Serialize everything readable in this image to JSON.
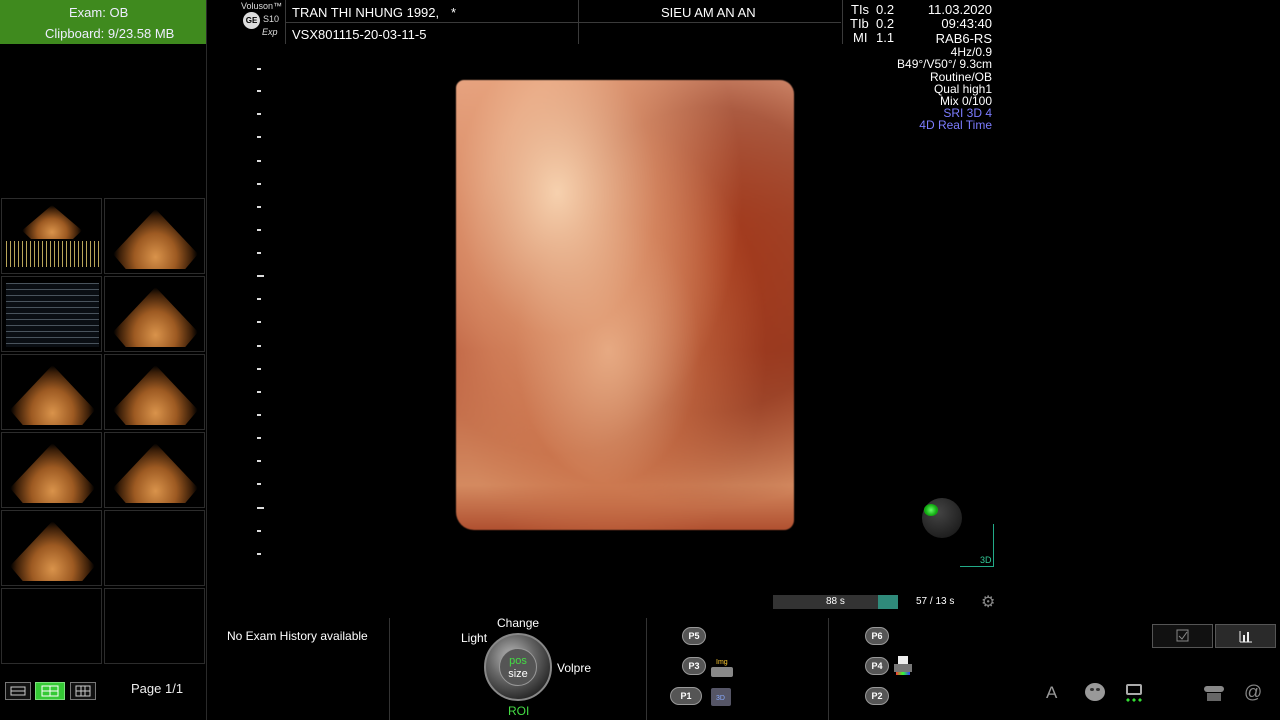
{
  "left_panel": {
    "exam_label": "Exam: OB",
    "clipboard_label": "Clipboard: 9/23.58 MB",
    "page_label": "Page 1/1"
  },
  "header": {
    "brand": "Voluson™",
    "model": "S10",
    "model_sub": "Exp",
    "ge_logo": "GE",
    "patient_name": "TRAN THI NHUNG 1992,",
    "patient_flag": "*",
    "patient_id": "VSX801115-20-03-11-5",
    "facility": "SIEU AM AN AN",
    "tis_label": "TIs",
    "tis_value": "0.2",
    "tib_label": "TIb",
    "tib_value": "0.2",
    "mi_label": "MI",
    "mi_value": "1.1",
    "date": "11.03.2020",
    "time": "09:43:40",
    "probe": "RAB6-RS"
  },
  "scan_info": {
    "freq": "4Hz/0.9",
    "angles": "B49°/V50°/ 9.3cm",
    "preset": "Routine/OB",
    "quality": "Qual high1",
    "mix": "Mix 0/100",
    "sri": "SRI 3D 4",
    "mode": "4D Real Time"
  },
  "viewer": {
    "orientation_label": "3D",
    "cine_time": "88 s",
    "cine_frames": "57 / 13 s",
    "cine_fill_fraction": 0.16
  },
  "bottom": {
    "exam_history": "No Exam History available",
    "dial_top": "Change",
    "dial_left": "Light",
    "dial_right": "Volpre",
    "dial_bottom": "ROI",
    "dial_center_top": "pos",
    "dial_center_bottom": "size",
    "p_buttons": [
      "P5",
      "P3",
      "P1",
      "P6",
      "P4",
      "P2"
    ],
    "img_label": "Img",
    "d3_label": "3D",
    "tool_a": "A",
    "tool_at": "@"
  }
}
